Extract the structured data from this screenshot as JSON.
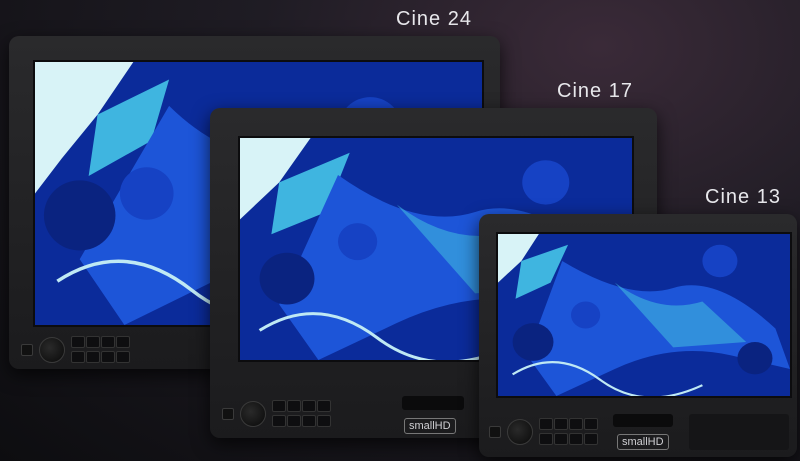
{
  "labels": {
    "cine24": "Cine 24",
    "cine17": "Cine 17",
    "cine13": "Cine 13"
  },
  "brand": "smallHD",
  "colors": {
    "bezel": "#1f1f21",
    "screen_deep": "#0a2a8c",
    "screen_mid": "#1d55d8",
    "screen_light": "#3fb5e0",
    "screen_white": "#d8f3f7"
  }
}
